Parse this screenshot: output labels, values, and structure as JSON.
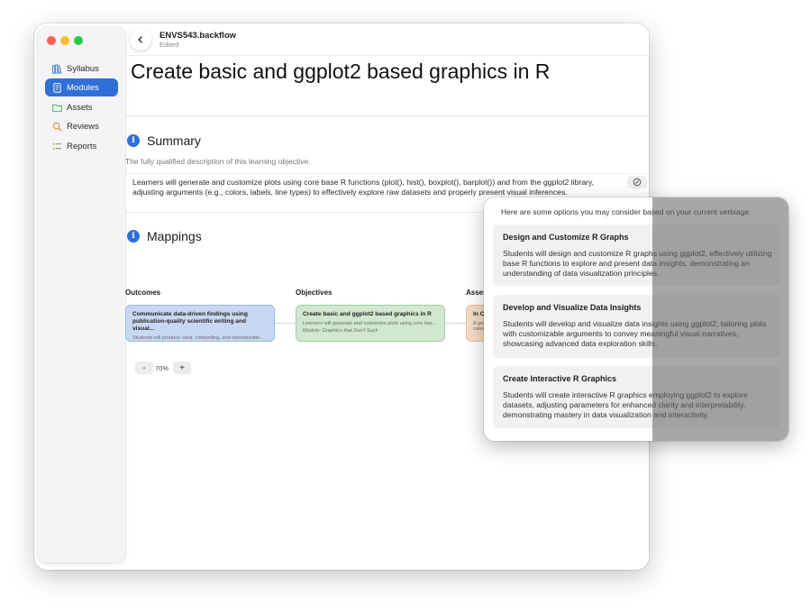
{
  "app": {
    "document_title": "ENVS543.backflow",
    "document_status": "Edited"
  },
  "sidebar": {
    "items": [
      {
        "label": "Syllabus",
        "icon": "books-icon",
        "active": false
      },
      {
        "label": "Modules",
        "icon": "document-icon",
        "active": true
      },
      {
        "label": "Assets",
        "icon": "folder-icon",
        "active": false
      },
      {
        "label": "Reviews",
        "icon": "magnifier-icon",
        "active": false
      },
      {
        "label": "Reports",
        "icon": "list-icon",
        "active": false
      }
    ]
  },
  "page": {
    "title": "Create basic and ggplot2 based graphics in R"
  },
  "summary": {
    "heading": "Summary",
    "description": "The fully qualified description of this learning objective.",
    "text": "Learners will generate and customize plots using core base R functions (plot(), hist(), boxplot(), barplot()) and from the ggplot2 library, adjusting arguments (e.g., colors, labels, line types) to effectively explore raw datasets and properly present visual inferences."
  },
  "mappings": {
    "heading": "Mappings",
    "columns": [
      "Outcomes",
      "Objectives",
      "Asses"
    ],
    "outcome_node": {
      "title": "Communicate data-driven findings using publication-quality scientific writing and visual...",
      "desc": "Students will produce clear, compelling, and reproducible..."
    },
    "objective_node": {
      "title": "Create basic and ggplot2 based graphics in R",
      "desc": "Learners will generate and customize plots using core bas...",
      "module": "Module: Graphics that Don't Suck"
    },
    "assessment_node": {
      "title": "In Cl",
      "desc": "A ger",
      "desc2": "categ"
    },
    "zoom": {
      "minus": "-",
      "value": "70%",
      "plus": "+"
    }
  },
  "suggestions": {
    "intro": "Here are some options you may consider based on your current verbiage.",
    "items": [
      {
        "title": "Design and Customize R Graphs",
        "body": "Students will design and customize R graphs using ggplot2, effectively utilizing base R functions to explore and present data insights, demonstrating an understanding of data visualization principles."
      },
      {
        "title": "Develop and Visualize Data Insights",
        "body": "Students will develop and visualize data insights using ggplot2, tailoring plots with customizable arguments to convey meaningful visual narratives, showcasing advanced data exploration skills."
      },
      {
        "title": "Create Interactive R Graphics",
        "body": "Students will create interactive R graphics employing ggplot2 to explore datasets, adjusting parameters for enhanced clarity and interpretability, demonstrating mastery in data visualization and interactivity."
      }
    ]
  },
  "colors": {
    "accent": "#2f6fd6",
    "outcome_node": "#c9d8f2",
    "objective_node": "#cfe8cf",
    "assessment_node": "#f5dcc6"
  }
}
